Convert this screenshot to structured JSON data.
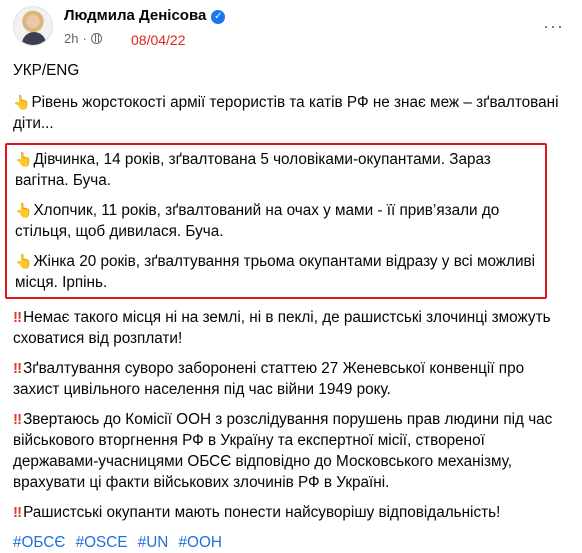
{
  "post": {
    "author": "Людмила Денісова",
    "time": "2h",
    "date_annotation": "08/04/22",
    "more_icon": "ellipsis-icon",
    "lang_line": "УКР/ENG",
    "intro": "Рівень жорстокості армії терористів та катів РФ не знає меж – зґвалтовані діти...",
    "highlighted": [
      "Дівчинка, 14 років, зґвалтована 5 чоловіками-окупантами. Зараз вагітна. Буча.",
      "Хлопчик, 11 років, зґвалтований на очах у мами - її прив’язали до стільця, щоб дивилася. Буча.",
      "Жінка 20 років, зґвалтування трьома окупантами відразу у всі можливі місця. Ірпінь."
    ],
    "paragraphs": [
      "Немає такого місця ні на землі, ні в пеклі, де рашистські злочинці зможуть сховатися від розплати!",
      "Зґвалтування суворо заборонені статтею 27 Женевської конвенції про захист цивільного населення під час війни 1949 року.",
      "Звертаюсь до Комісії ООН з розслідування порушень прав людини під час військового вторгнення РФ в Україну та експертної місії, створеної державами-учасницями ОБСЄ відповідно до Московського механізму, врахувати ці факти військових злочинів РФ в Україні.",
      "Рашистські окупанти мають понести найсуворішу відповідальність!"
    ],
    "hashtags": [
      "#ОБСЄ",
      "#OSCE",
      "#UN",
      "#ООН"
    ],
    "colors": {
      "highlight_border": "#e0161c",
      "date_text": "#e0261b",
      "link": "#216fdb"
    }
  }
}
